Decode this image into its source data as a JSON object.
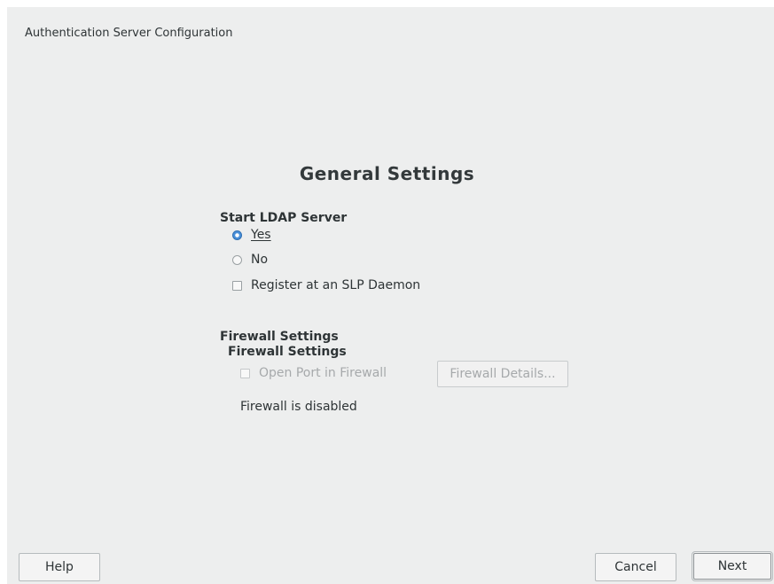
{
  "window": {
    "title": "Authentication Server Configuration"
  },
  "main": {
    "heading": "General Settings",
    "ldap": {
      "label": "Start LDAP Server",
      "options": [
        {
          "label": "Yes",
          "selected": true
        },
        {
          "label": "No",
          "selected": false
        }
      ],
      "slp_label": "Register at an SLP Daemon",
      "slp_checked": false
    },
    "firewall": {
      "outer_label": "Firewall Settings",
      "inner_label": "Firewall Settings",
      "open_port_label": "Open Port in Firewall",
      "open_port_checked": false,
      "details_button": "Firewall Details...",
      "status": "Firewall is disabled"
    }
  },
  "footer": {
    "help_label": "Help",
    "cancel_label": "Cancel",
    "next_label": "Next"
  }
}
